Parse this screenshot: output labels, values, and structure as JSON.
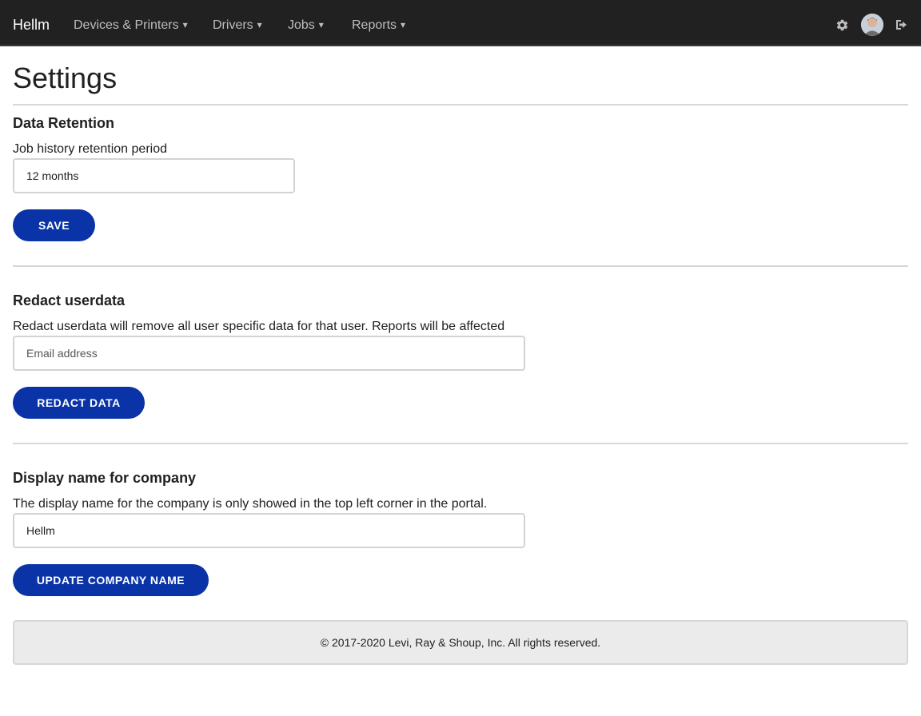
{
  "navbar": {
    "brand": "Hellm",
    "items": [
      {
        "label": "Devices & Printers",
        "caret": "▾"
      },
      {
        "label": "Drivers",
        "caret": "▾"
      },
      {
        "label": "Jobs",
        "caret": "▾"
      },
      {
        "label": "Reports",
        "caret": "▾"
      }
    ],
    "icons": [
      "gear-icon",
      "avatar",
      "logout-icon"
    ]
  },
  "page": {
    "title": "Settings"
  },
  "data_retention": {
    "title": "Data Retention",
    "label": "Job history retention period",
    "value": "12 months",
    "button": "SAVE"
  },
  "redact": {
    "title": "Redact userdata",
    "description": "Redact userdata will remove all user specific data for that user. Reports will be affected",
    "placeholder": "Email address",
    "button": "REDACT DATA"
  },
  "company": {
    "title": "Display name for company",
    "description": "The display name for the company is only showed in the top left corner in the portal.",
    "value": "Hellm",
    "button": "UPDATE COMPANY NAME"
  },
  "footer": {
    "text": "© 2017-2020 Levi, Ray & Shoup, Inc. All rights reserved."
  },
  "colors": {
    "navbar": "#212121",
    "primary_button": "#0a33a8",
    "footer_bg": "#ebebeb"
  }
}
